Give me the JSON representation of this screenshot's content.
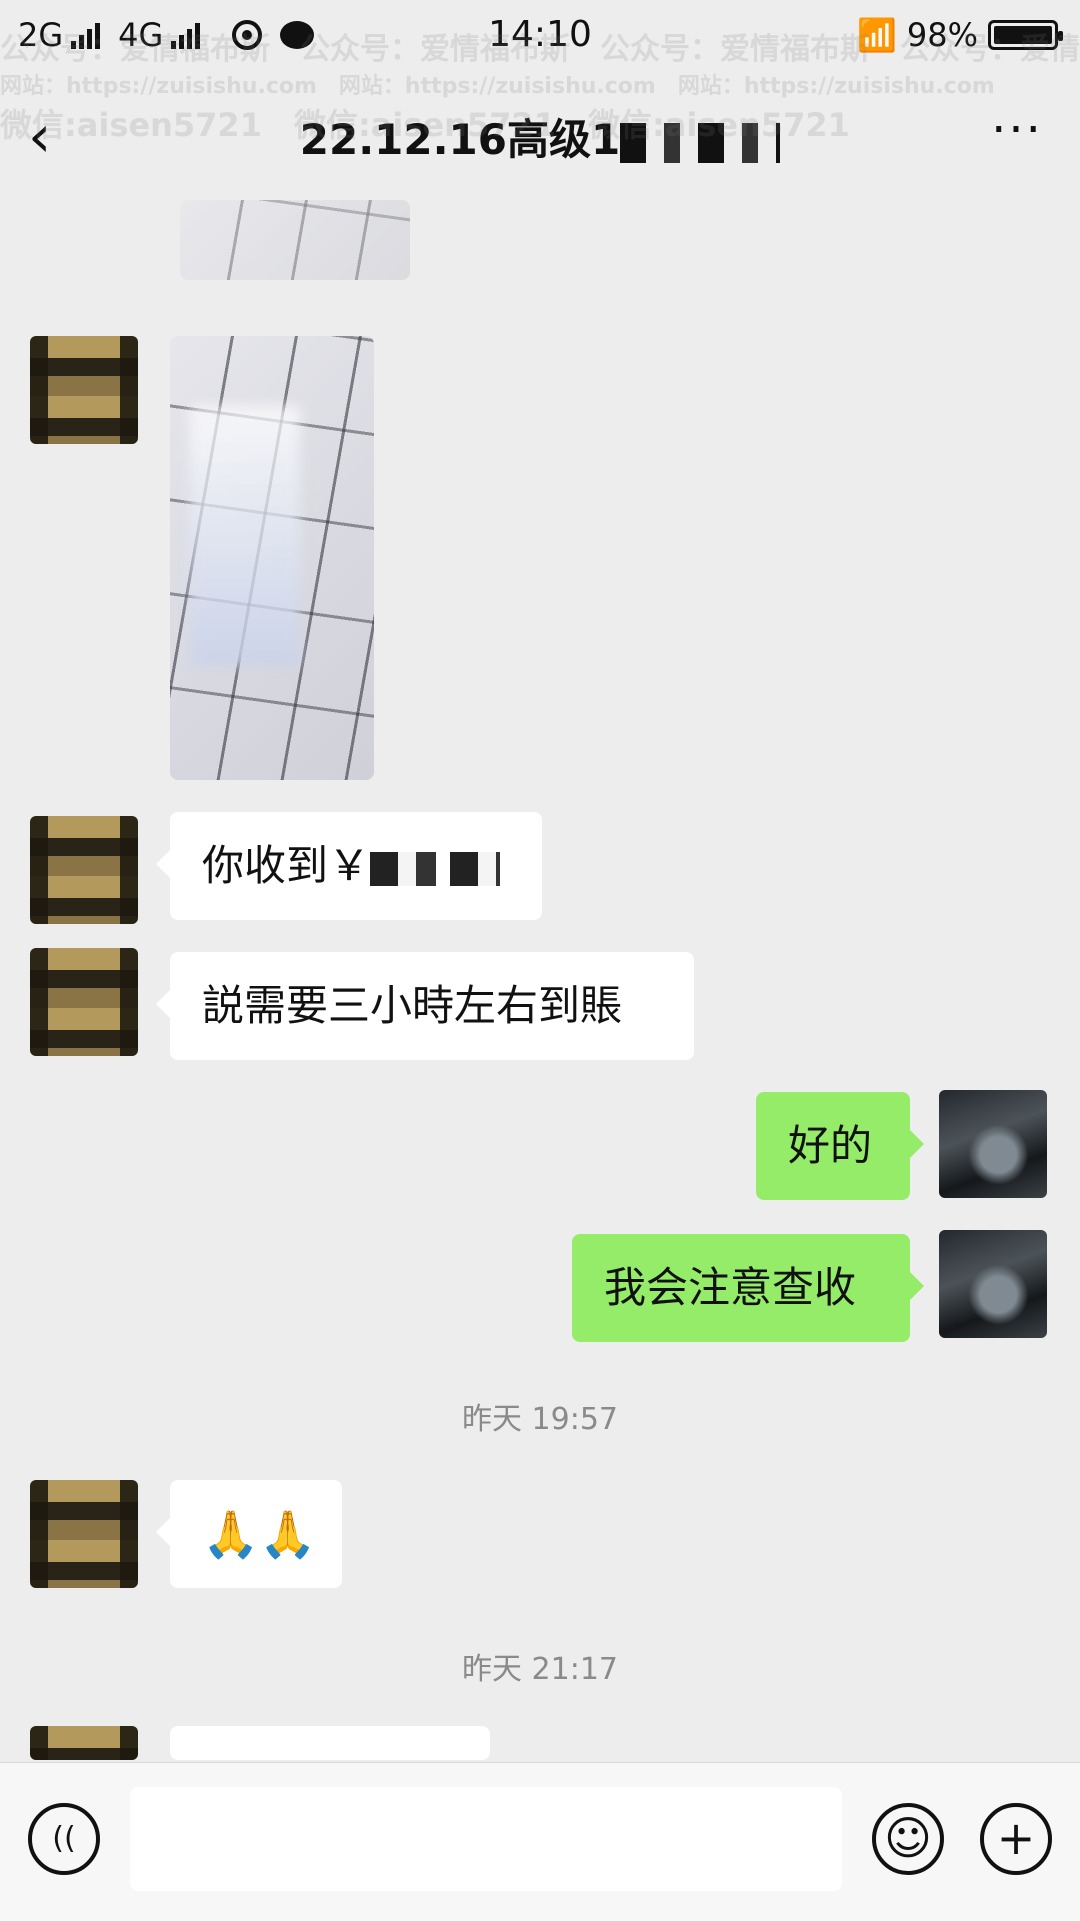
{
  "status_bar": {
    "network_1": "2G",
    "network_2": "4G",
    "time": "14:10",
    "battery": "98%"
  },
  "header": {
    "title": "22.12.16高级1",
    "back_icon": "chevron-left-icon",
    "more_icon": "more-dots-icon"
  },
  "messages": {
    "m1": {
      "text": "你收到￥"
    },
    "m2": {
      "text": "説需要三小時左右到賬"
    },
    "m3": {
      "text": "好的"
    },
    "m4": {
      "text": "我会注意查收"
    },
    "m5": {
      "text": "🙏🙏"
    }
  },
  "timestamps": {
    "t1": "昨天 19:57",
    "t2": "昨天 21:17"
  },
  "watermark": {
    "line1": "公众号：爱情福布斯",
    "line2": "网站：https://zuisishu.com",
    "line3": "微信:aisen5721"
  },
  "input_bar": {
    "placeholder": "",
    "voice_icon": "voice-icon",
    "emoji_icon": "emoji-icon",
    "plus_icon": "plus-icon"
  },
  "colors": {
    "background": "#ededed",
    "my_bubble": "#95ec69",
    "other_bubble": "#ffffff"
  }
}
